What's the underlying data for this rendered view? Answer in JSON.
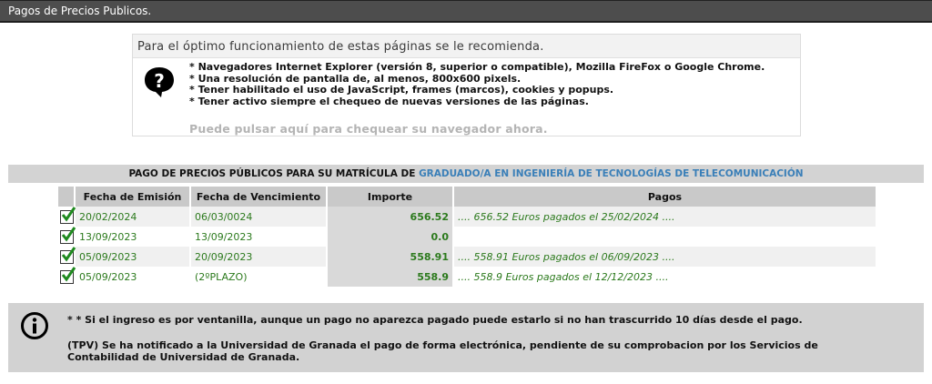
{
  "header": {
    "title": "Pagos de Precios Publicos."
  },
  "recommendations": {
    "heading": "Para el óptimo funcionamiento de estas páginas se le recomienda.",
    "items": [
      "* Navegadores Internet Explorer (versión 8, superior o compatible), Mozilla FireFox o Google Chrome.",
      "* Una resolución de pantalla de, al menos, 800x600 pixels.",
      "* Tener habilitado el uso de JavaScript, frames (marcos), cookies y popups.",
      "* Tener activo siempre el chequeo de nuevas versiones de las páginas."
    ],
    "check_link": "Puede pulsar aquí para chequear su navegador ahora."
  },
  "payments": {
    "header_prefix": "PAGO DE PRECIOS PÚBLICOS PARA SU MATRÍCULA DE",
    "degree": "GRADUADO/A EN INGENIERÍA DE TECNOLOGÍAS DE TELECOMUNICACIÓN",
    "columns": [
      "Fecha de Emisión",
      "Fecha de Vencimiento",
      "Importe",
      "Pagos"
    ],
    "rows": [
      {
        "emision": "20/02/2024",
        "vencimiento": "06/03/0024",
        "importe": "656.52",
        "pagos": ".... 656.52 Euros pagados el 25/02/2024 ...."
      },
      {
        "emision": "13/09/2023",
        "vencimiento": "13/09/2023",
        "importe": "0.0",
        "pagos": ""
      },
      {
        "emision": "05/09/2023",
        "vencimiento": "20/09/2023",
        "importe": "558.91",
        "pagos": ".... 558.91 Euros pagados el 06/09/2023 ...."
      },
      {
        "emision": "05/09/2023",
        "vencimiento": "(2ºPLAZO)",
        "importe": "558.9",
        "pagos": ".... 558.9 Euros pagados el 12/12/2023 ...."
      }
    ]
  },
  "info": {
    "note1": "* * Si el ingreso es por ventanilla, aunque un pago no aparezca pagado puede estarlo si no han trascurrido 10 días desde el pago.",
    "note2": "(TPV) Se ha notificado a la Universidad de Granada el pago de forma electrónica, pendiente de su comprobacion por los Servicios de Contabilidad de Universidad de Granada."
  },
  "colors": {
    "topbar": "#4d4d4d",
    "green_text": "#2c7a1d",
    "degree_link": "#3a7fb8",
    "info_bg": "#d2d2d2"
  }
}
